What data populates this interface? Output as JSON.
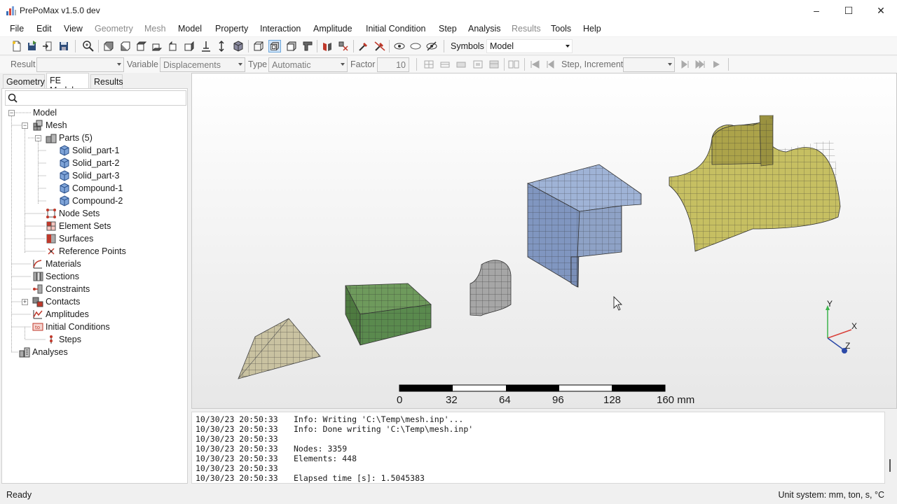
{
  "window": {
    "title": "PrePoMax v1.5.0 dev"
  },
  "menu": [
    "File",
    "Edit",
    "View",
    "Geometry",
    "Mesh",
    "Model",
    "Property",
    "Interaction",
    "Amplitude",
    "Initial Condition",
    "Step",
    "Analysis",
    "Results",
    "Tools",
    "Help"
  ],
  "menu_disabled": [
    "Geometry",
    "Mesh",
    "Results"
  ],
  "toolbar": {
    "symbols_label": "Symbols",
    "symbols_value": "Model"
  },
  "results_toolbar": {
    "result_label": "Result",
    "variable_label": "Variable",
    "variable_value": "Displacements",
    "type_label": "Type",
    "type_value": "Automatic",
    "factor_label": "Factor",
    "factor_value": "10",
    "step_increment_label": "Step, Increment"
  },
  "tabs": [
    "Geometry",
    "FE Model",
    "Results"
  ],
  "active_tab": "FE Model",
  "tree": {
    "model": "Model",
    "mesh": "Mesh",
    "parts": "Parts (5)",
    "part_items": [
      "Solid_part-1",
      "Solid_part-2",
      "Solid_part-3",
      "Compound-1",
      "Compound-2"
    ],
    "node_sets": "Node Sets",
    "element_sets": "Element Sets",
    "surfaces": "Surfaces",
    "reference_points": "Reference Points",
    "materials": "Materials",
    "sections": "Sections",
    "constraints": "Constraints",
    "contacts": "Contacts",
    "amplitudes": "Amplitudes",
    "initial_conditions": "Initial Conditions",
    "steps": "Steps",
    "analyses": "Analyses"
  },
  "viewport": {
    "scale_labels": [
      "0",
      "32",
      "64",
      "96",
      "128",
      "160 mm"
    ],
    "axes": {
      "x": "X",
      "y": "Y",
      "z": "Z"
    },
    "colors": {
      "beige": "#c8c1a0",
      "green": "#5a8a4e",
      "gray": "#a4a4a4",
      "blue": "#8ea2c6",
      "olive": "#c2bb62"
    }
  },
  "console": [
    {
      "time": "10/30/23 20:50:33",
      "msg": "Info: Writing 'C:\\Temp\\mesh.inp'..."
    },
    {
      "time": "10/30/23 20:50:33",
      "msg": "Info: Done writing 'C:\\Temp\\mesh.inp'"
    },
    {
      "time": "10/30/23 20:50:33",
      "msg": ""
    },
    {
      "time": "10/30/23 20:50:33",
      "msg": "Nodes: 3359"
    },
    {
      "time": "10/30/23 20:50:33",
      "msg": "Elements: 448"
    },
    {
      "time": "10/30/23 20:50:33",
      "msg": ""
    },
    {
      "time": "10/30/23 20:50:33",
      "msg": "Elapsed time [s]: 1.5045383"
    }
  ],
  "status": {
    "left": "Ready",
    "right": "Unit system: mm, ton, s, °C"
  }
}
